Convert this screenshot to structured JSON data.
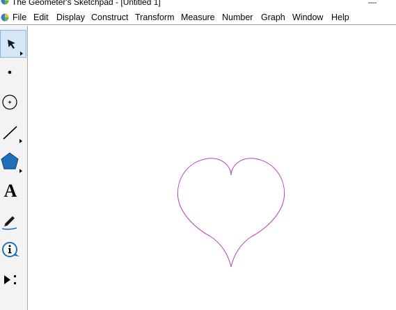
{
  "app": {
    "title": "The Geometer's Sketchpad - [Untitled 1]",
    "minimize_glyph": "—"
  },
  "menu": {
    "items": [
      "File",
      "Edit",
      "Display",
      "Construct",
      "Transform",
      "Measure",
      "Number",
      "Graph",
      "Window",
      "Help"
    ]
  },
  "toolbox": {
    "tools": [
      {
        "name": "arrow-select-tool",
        "icon": "arrow-icon",
        "selected": true
      },
      {
        "name": "point-tool",
        "icon": "point-icon"
      },
      {
        "name": "compass-tool",
        "icon": "circle-icon"
      },
      {
        "name": "straightedge-tool",
        "icon": "line-segment-icon"
      },
      {
        "name": "polygon-tool",
        "icon": "pentagon-icon"
      },
      {
        "name": "text-tool",
        "icon": "letter-a-icon",
        "text": "A"
      },
      {
        "name": "marker-tool",
        "icon": "pen-icon"
      },
      {
        "name": "information-tool",
        "icon": "info-icon"
      },
      {
        "name": "custom-tool",
        "icon": "play-menu-icon"
      }
    ]
  },
  "canvas": {
    "shapes": [
      {
        "name": "heart-curve",
        "stroke": "#b43fb4"
      }
    ]
  },
  "colors": {
    "heart_stroke": "#b43fb4",
    "toolbox_bg": "#f3f3f3",
    "selected_tool_bg": "#d4e6f8",
    "polygon_fill": "#1e6fb8"
  }
}
